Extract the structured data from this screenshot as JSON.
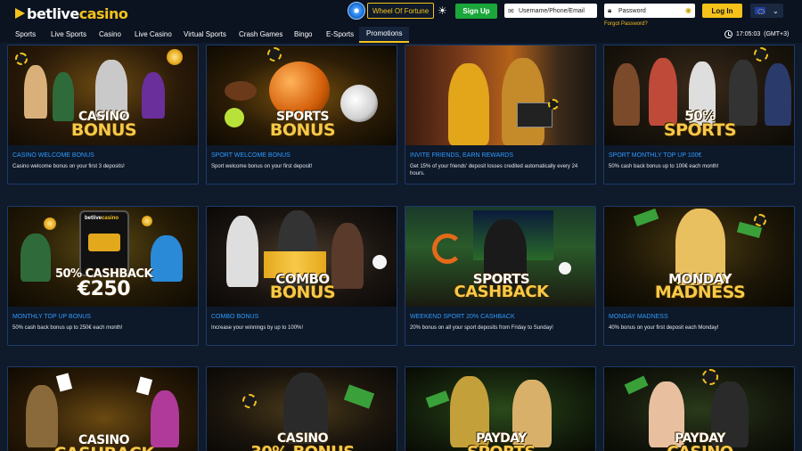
{
  "header": {
    "logo": {
      "part1": "betlive",
      "part2": "casino"
    },
    "wheel_of_fortune": "Wheel Of Fortune",
    "signup": "Sign Up",
    "username_placeholder": "Username/Phone/Email",
    "password_placeholder": "Password",
    "forgot_password": "Forgot Password?",
    "login": "Log In",
    "theme_icon": "sun-icon",
    "language_flag": "eu-flag-icon"
  },
  "nav": {
    "items": [
      "Sports",
      "Live Sports",
      "Casino",
      "Live Casino",
      "Virtual Sports",
      "Crash Games",
      "Bingo",
      "E-Sports",
      "Promotions"
    ],
    "active": "Promotions",
    "time": "17:05:03",
    "timezone": "(GMT+3)"
  },
  "colors": {
    "accent": "#f4c21a",
    "link": "#2f9bff",
    "signup": "#1aa63a",
    "background": "#0f1a2b"
  },
  "promotions": [
    {
      "banner": [
        "CASINO",
        "BONUS"
      ],
      "title": "CASINO WELCOME BONUS",
      "description": "Casino welcome bonus on your first 3 deposits!"
    },
    {
      "banner": [
        "SPORTS",
        "BONUS"
      ],
      "title": "SPORT WELCOME BONUS",
      "description": "Sport welcome bonus on your first deposit!"
    },
    {
      "banner": [],
      "title": "INVITE FRIENDS, EARN REWARDS",
      "description": "Get 15% of your friends' deposit losses credited automatically every 24 hours."
    },
    {
      "banner": [
        "50%",
        "SPORTS"
      ],
      "title": "SPORT MONTHLY TOP UP 100€",
      "description": "50% cash back bonus up to 100€ each month!"
    },
    {
      "banner": [
        "50% CASHBACK",
        "€250"
      ],
      "title": "MONTHLY TOP UP BONUS",
      "description": "50% cash back bonus up to 250€ each month!"
    },
    {
      "banner": [
        "COMBO",
        "BONUS"
      ],
      "title": "COMBO BONUS",
      "description": "Increase your winnings by up to 100%!"
    },
    {
      "banner": [
        "SPORTS",
        "CASHBACK"
      ],
      "title": "WEEKEND SPORT 20% CASHBACK",
      "description": "20% bonus on all your sport deposits from Friday to Sunday!"
    },
    {
      "banner": [
        "MONDAY",
        "MADNESS"
      ],
      "title": "MONDAY MADNESS",
      "description": "40% bonus on your first deposit each Monday!"
    },
    {
      "banner": [
        "CASINO",
        "CASHBACK"
      ],
      "title": "",
      "description": ""
    },
    {
      "banner": [
        "CASINO",
        "30% BONUS"
      ],
      "title": "",
      "description": ""
    },
    {
      "banner": [
        "PAYDAY",
        "SPORTS"
      ],
      "title": "",
      "description": ""
    },
    {
      "banner": [
        "PAYDAY",
        "CASINO"
      ],
      "title": "",
      "description": ""
    }
  ]
}
